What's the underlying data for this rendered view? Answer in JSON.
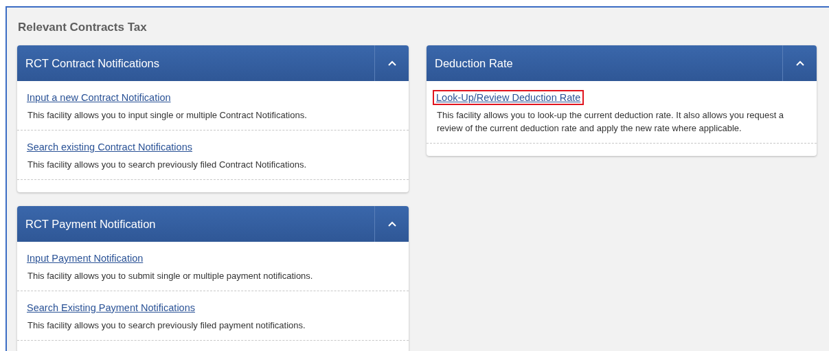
{
  "page_title": "Relevant Contracts Tax",
  "columns": [
    [
      {
        "title": "RCT Contract Notifications",
        "expanded": true,
        "items": [
          {
            "link": "Input a new Contract Notification",
            "description": "This facility allows you to input single or multiple Contract Notifications.",
            "highlighted": false
          },
          {
            "link": "Search existing Contract Notifications",
            "description": "This facility allows you to search previously filed Contract Notifications.",
            "highlighted": false
          }
        ]
      },
      {
        "title": "RCT Payment Notification",
        "expanded": true,
        "items": [
          {
            "link": "Input Payment Notification",
            "description": "This facility allows you to submit single or multiple payment notifications.",
            "highlighted": false
          },
          {
            "link": "Search Existing Payment Notifications",
            "description": "This facility allows you to search previously filed payment notifications.",
            "highlighted": false
          }
        ]
      }
    ],
    [
      {
        "title": "Deduction Rate",
        "expanded": true,
        "items": [
          {
            "link": "Look-Up/Review Deduction Rate",
            "description": "This facility allows you to look-up the current deduction rate. It also allows you request a review of the current deduction rate and apply the new rate where applicable.",
            "highlighted": true
          }
        ]
      }
    ]
  ]
}
